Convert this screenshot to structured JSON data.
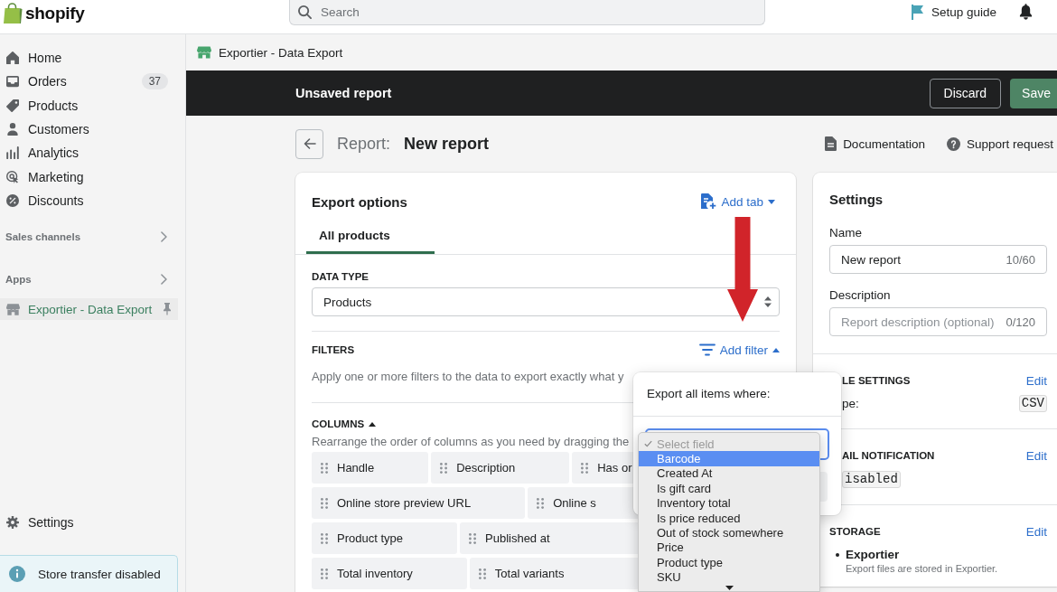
{
  "top_bar": {
    "logo": "shopify",
    "search": {
      "placeholder": "Search"
    },
    "setup_guide": "Setup guide"
  },
  "sidebar": {
    "nav": [
      {
        "label": "Home",
        "selected": false
      },
      {
        "label": "Orders",
        "badge": "37",
        "selected": false
      },
      {
        "label": "Products",
        "selected": false
      },
      {
        "label": "Customers",
        "selected": false
      },
      {
        "label": "Analytics",
        "selected": false
      },
      {
        "label": "Marketing",
        "selected": false
      },
      {
        "label": "Discounts",
        "selected": false
      }
    ],
    "sections": [
      {
        "title": "Sales channels",
        "expanded": false
      },
      {
        "title": "Apps",
        "expanded": false
      }
    ],
    "apps": [
      {
        "label": "Exportier - Data Export",
        "selected": true
      }
    ],
    "settings": {
      "label": "Settings",
      "selected": false
    },
    "notice": "Store transfer disabled"
  },
  "app_header": {
    "title": "Exportier - Data Export"
  },
  "save_bar": {
    "title": "Unsaved report",
    "buttons": [
      {
        "label": "Discard",
        "kind": "secondary"
      },
      {
        "label": "Save",
        "kind": "primary"
      }
    ]
  },
  "page_header": {
    "prefix": "Report:",
    "title": "New report",
    "links": [
      "Documentation",
      "Support request"
    ]
  },
  "export_options": {
    "title": "Export options",
    "add_tab": {
      "label": "Add tab",
      "expanded": false
    },
    "tabs": [
      {
        "label": "All products",
        "selected": true
      }
    ],
    "data_type": {
      "label": "DATA TYPE",
      "value": "Products"
    },
    "filters": {
      "label": "FILTERS",
      "add_filter": {
        "label": "Add filter",
        "expanded": true
      },
      "help": "Apply one or more filters to the data to export exactly what y"
    },
    "columns": {
      "label": "COLUMNS",
      "expanded": true,
      "help": "Rearrange the order of columns as you need by dragging the",
      "rows": [
        [
          "Handle",
          "Description",
          "Has or"
        ],
        [
          "Online store preview URL",
          "Online s"
        ],
        [
          "Product type",
          "Published at"
        ],
        [
          "Total inventory",
          "Total variants"
        ]
      ]
    }
  },
  "filter_popover": {
    "title": "Export all items where:",
    "field": {
      "focused": true
    },
    "options": [
      {
        "label": "Select field",
        "selected": true,
        "highlighted": false,
        "disabled": true
      },
      {
        "label": "Barcode",
        "selected": false,
        "highlighted": true,
        "disabled": false
      },
      {
        "label": "Created At",
        "selected": false,
        "highlighted": false,
        "disabled": false
      },
      {
        "label": "Is gift card",
        "selected": false,
        "highlighted": false,
        "disabled": false
      },
      {
        "label": "Inventory total",
        "selected": false,
        "highlighted": false,
        "disabled": false
      },
      {
        "label": "Is price reduced",
        "selected": false,
        "highlighted": false,
        "disabled": false
      },
      {
        "label": "Out of stock somewhere",
        "selected": false,
        "highlighted": false,
        "disabled": false
      },
      {
        "label": "Price",
        "selected": false,
        "highlighted": false,
        "disabled": false
      },
      {
        "label": "Product type",
        "selected": false,
        "highlighted": false,
        "disabled": false
      },
      {
        "label": "SKU",
        "selected": false,
        "highlighted": false,
        "disabled": false
      }
    ]
  },
  "settings": {
    "title": "Settings",
    "name": {
      "label": "Name",
      "value": "New report",
      "counter": "10/60"
    },
    "description": {
      "label": "Description",
      "placeholder": "Report description (optional)",
      "counter": "0/120"
    },
    "sections": [
      {
        "kind": "type",
        "title": "LE SETTINGS",
        "action": "Edit",
        "label": "pe:",
        "value": "CSV"
      },
      {
        "kind": "status",
        "title": "AIL NOTIFICATION",
        "action": "Edit",
        "value": "isabled"
      },
      {
        "kind": "list",
        "title": "STORAGE",
        "action": "Edit",
        "items": [
          {
            "title": "Exportier",
            "note": "Export files are stored in Exportier."
          }
        ]
      }
    ]
  }
}
